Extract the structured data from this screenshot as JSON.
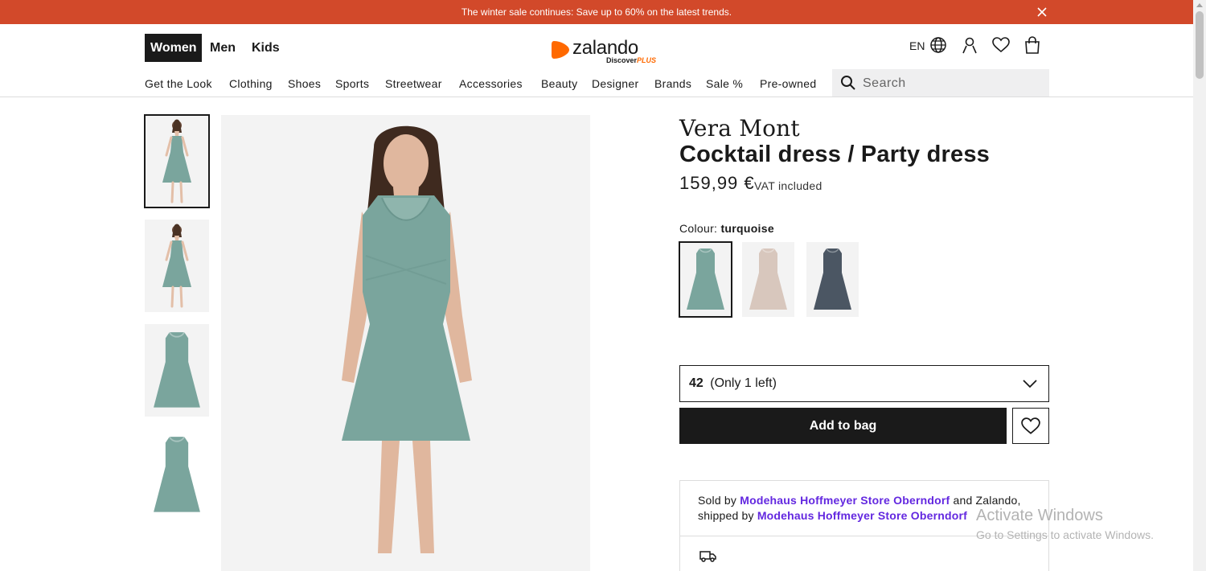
{
  "promo": {
    "text": "The winter sale continues: Save up to 60% on the latest trends."
  },
  "header": {
    "genders": [
      "Women",
      "Men",
      "Kids"
    ],
    "logo": {
      "word": "zalando",
      "sub_a": "Discover",
      "sub_b": "PLUS"
    },
    "language": "EN"
  },
  "nav": {
    "items": [
      "Get the Look",
      "Clothing",
      "Shoes",
      "Sports",
      "Streetwear",
      "Accessories",
      "Beauty",
      "Designer",
      "Brands",
      "Sale %",
      "Pre-owned"
    ],
    "search_placeholder": "Search"
  },
  "product": {
    "brand": "Vera Mont",
    "name": "Cocktail dress / Party dress",
    "price": "159,99 €",
    "vat": "VAT included",
    "colour_label": "Colour:",
    "colour_value": "turquoise",
    "colours": [
      {
        "name": "turquoise",
        "color": "#7aa59d"
      },
      {
        "name": "beige",
        "color": "#d8c7bd"
      },
      {
        "name": "dark blue",
        "color": "#4b5663"
      }
    ],
    "size": {
      "value": "42",
      "note": "(Only 1 left)"
    },
    "add_to_bag": "Add to bag"
  },
  "seller": {
    "sold_by": "Sold by",
    "store": "Modehaus Hoffmeyer Store Oberndorf",
    "and": "and Zalando,",
    "shipped_by": "shipped by",
    "store2": "Modehaus Hoffmeyer Store Oberndorf"
  },
  "watermark": {
    "line1": "Activate Windows",
    "line2": "Go to Settings to activate Windows."
  },
  "colors": {
    "promo": "#d2492a",
    "accent": "#ff6900",
    "link": "#6328e0",
    "dress": "#7aa59d"
  }
}
